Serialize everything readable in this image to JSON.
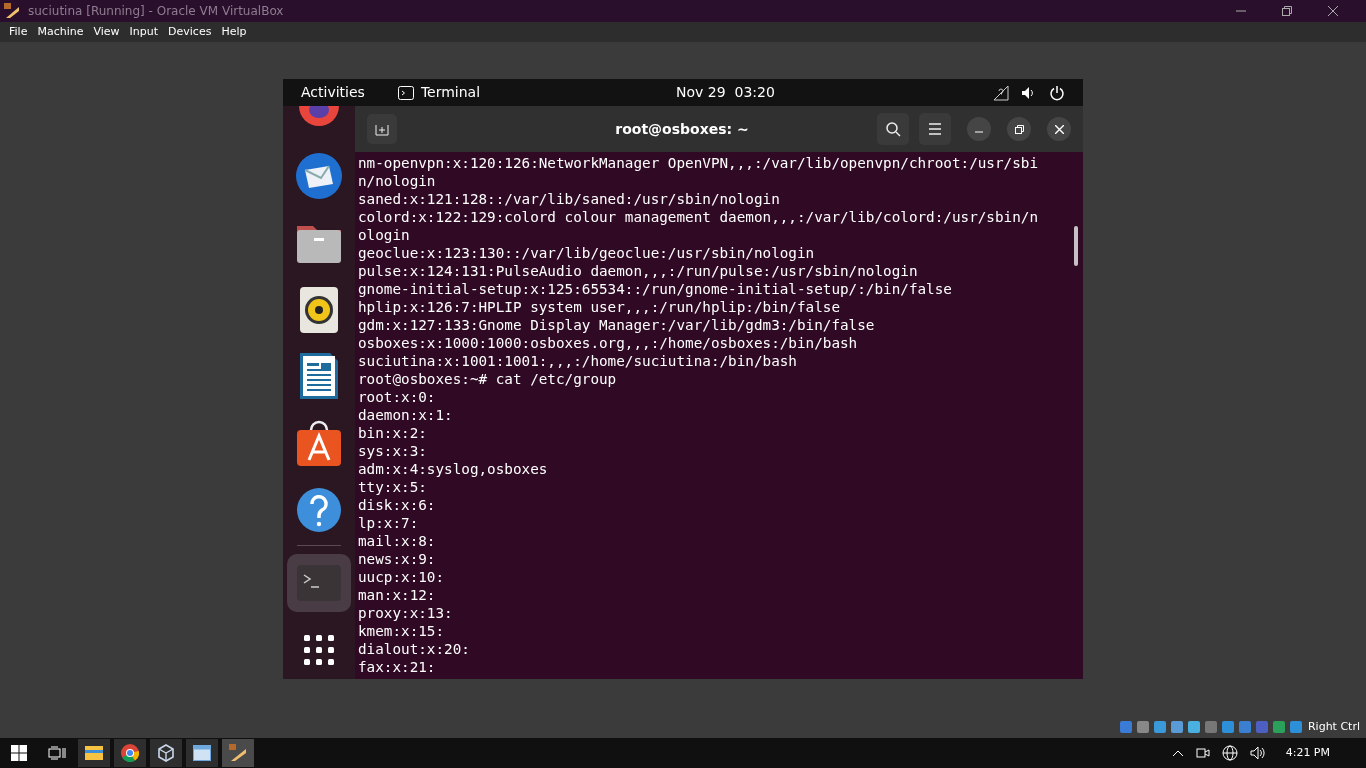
{
  "window": {
    "title": "suciutina [Running] - Oracle VM VirtualBox"
  },
  "menu": [
    "File",
    "Machine",
    "View",
    "Input",
    "Devices",
    "Help"
  ],
  "gnome_bar": {
    "activities": "Activities",
    "app": "Terminal",
    "clock": "Nov 29  03:20"
  },
  "dock": [
    {
      "kind": "firefox",
      "selected": false
    },
    {
      "kind": "mail",
      "selected": false
    },
    {
      "kind": "files",
      "selected": false
    },
    {
      "kind": "music",
      "selected": false
    },
    {
      "kind": "writer",
      "selected": false
    },
    {
      "kind": "store",
      "selected": false
    },
    {
      "kind": "help",
      "selected": false
    },
    {
      "kind": "terminal",
      "selected": true
    },
    {
      "kind": "apps",
      "selected": false
    }
  ],
  "terminal": {
    "title": "root@osboxes: ~",
    "lines": [
      "nm-openvpn:x:120:126:NetworkManager OpenVPN,,,:/var/lib/openvpn/chroot:/usr/sbi",
      "n/nologin",
      "saned:x:121:128::/var/lib/saned:/usr/sbin/nologin",
      "colord:x:122:129:colord colour management daemon,,,:/var/lib/colord:/usr/sbin/n",
      "ologin",
      "geoclue:x:123:130::/var/lib/geoclue:/usr/sbin/nologin",
      "pulse:x:124:131:PulseAudio daemon,,,:/run/pulse:/usr/sbin/nologin",
      "gnome-initial-setup:x:125:65534::/run/gnome-initial-setup/:/bin/false",
      "hplip:x:126:7:HPLIP system user,,,:/run/hplip:/bin/false",
      "gdm:x:127:133:Gnome Display Manager:/var/lib/gdm3:/bin/false",
      "osboxes:x:1000:1000:osboxes.org,,,:/home/osboxes:/bin/bash",
      "suciutina:x:1001:1001:,,,:/home/suciutina:/bin/bash",
      "root@osboxes:~# cat /etc/group",
      "root:x:0:",
      "daemon:x:1:",
      "bin:x:2:",
      "sys:x:3:",
      "adm:x:4:syslog,osboxes",
      "tty:x:5:",
      "disk:x:6:",
      "lp:x:7:",
      "mail:x:8:",
      "news:x:9:",
      "uucp:x:10:",
      "man:x:12:",
      "proxy:x:13:",
      "kmem:x:15:",
      "dialout:x:20:",
      "fax:x:21:"
    ]
  },
  "vbox_status": {
    "host_key": "Right Ctrl"
  },
  "taskbar": {
    "apps": [
      {
        "kind": "explorer",
        "selected": false
      },
      {
        "kind": "chrome",
        "selected": false
      },
      {
        "kind": "virtualbox",
        "selected": false
      },
      {
        "kind": "window",
        "selected": false
      },
      {
        "kind": "vm",
        "selected": true
      }
    ],
    "clock": "4:21 PM"
  }
}
